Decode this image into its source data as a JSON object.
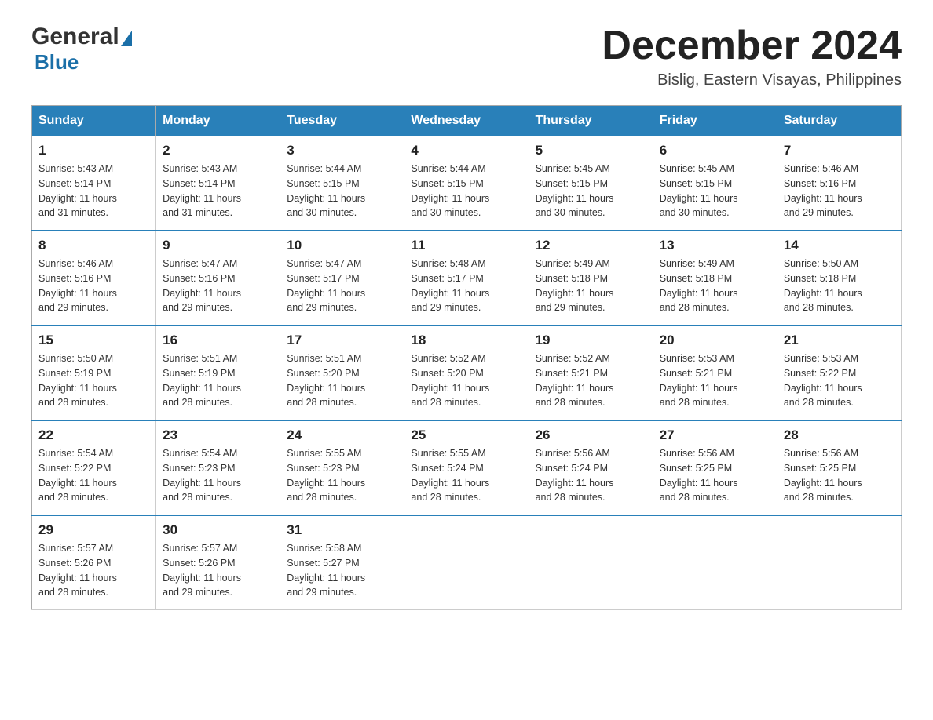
{
  "header": {
    "month_title": "December 2024",
    "location": "Bislig, Eastern Visayas, Philippines",
    "logo_general": "General",
    "logo_blue": "Blue"
  },
  "days_of_week": [
    "Sunday",
    "Monday",
    "Tuesday",
    "Wednesday",
    "Thursday",
    "Friday",
    "Saturday"
  ],
  "weeks": [
    [
      {
        "day": "1",
        "sunrise": "5:43 AM",
        "sunset": "5:14 PM",
        "daylight": "11 hours and 31 minutes."
      },
      {
        "day": "2",
        "sunrise": "5:43 AM",
        "sunset": "5:14 PM",
        "daylight": "11 hours and 31 minutes."
      },
      {
        "day": "3",
        "sunrise": "5:44 AM",
        "sunset": "5:15 PM",
        "daylight": "11 hours and 30 minutes."
      },
      {
        "day": "4",
        "sunrise": "5:44 AM",
        "sunset": "5:15 PM",
        "daylight": "11 hours and 30 minutes."
      },
      {
        "day": "5",
        "sunrise": "5:45 AM",
        "sunset": "5:15 PM",
        "daylight": "11 hours and 30 minutes."
      },
      {
        "day": "6",
        "sunrise": "5:45 AM",
        "sunset": "5:15 PM",
        "daylight": "11 hours and 30 minutes."
      },
      {
        "day": "7",
        "sunrise": "5:46 AM",
        "sunset": "5:16 PM",
        "daylight": "11 hours and 29 minutes."
      }
    ],
    [
      {
        "day": "8",
        "sunrise": "5:46 AM",
        "sunset": "5:16 PM",
        "daylight": "11 hours and 29 minutes."
      },
      {
        "day": "9",
        "sunrise": "5:47 AM",
        "sunset": "5:16 PM",
        "daylight": "11 hours and 29 minutes."
      },
      {
        "day": "10",
        "sunrise": "5:47 AM",
        "sunset": "5:17 PM",
        "daylight": "11 hours and 29 minutes."
      },
      {
        "day": "11",
        "sunrise": "5:48 AM",
        "sunset": "5:17 PM",
        "daylight": "11 hours and 29 minutes."
      },
      {
        "day": "12",
        "sunrise": "5:49 AM",
        "sunset": "5:18 PM",
        "daylight": "11 hours and 29 minutes."
      },
      {
        "day": "13",
        "sunrise": "5:49 AM",
        "sunset": "5:18 PM",
        "daylight": "11 hours and 28 minutes."
      },
      {
        "day": "14",
        "sunrise": "5:50 AM",
        "sunset": "5:18 PM",
        "daylight": "11 hours and 28 minutes."
      }
    ],
    [
      {
        "day": "15",
        "sunrise": "5:50 AM",
        "sunset": "5:19 PM",
        "daylight": "11 hours and 28 minutes."
      },
      {
        "day": "16",
        "sunrise": "5:51 AM",
        "sunset": "5:19 PM",
        "daylight": "11 hours and 28 minutes."
      },
      {
        "day": "17",
        "sunrise": "5:51 AM",
        "sunset": "5:20 PM",
        "daylight": "11 hours and 28 minutes."
      },
      {
        "day": "18",
        "sunrise": "5:52 AM",
        "sunset": "5:20 PM",
        "daylight": "11 hours and 28 minutes."
      },
      {
        "day": "19",
        "sunrise": "5:52 AM",
        "sunset": "5:21 PM",
        "daylight": "11 hours and 28 minutes."
      },
      {
        "day": "20",
        "sunrise": "5:53 AM",
        "sunset": "5:21 PM",
        "daylight": "11 hours and 28 minutes."
      },
      {
        "day": "21",
        "sunrise": "5:53 AM",
        "sunset": "5:22 PM",
        "daylight": "11 hours and 28 minutes."
      }
    ],
    [
      {
        "day": "22",
        "sunrise": "5:54 AM",
        "sunset": "5:22 PM",
        "daylight": "11 hours and 28 minutes."
      },
      {
        "day": "23",
        "sunrise": "5:54 AM",
        "sunset": "5:23 PM",
        "daylight": "11 hours and 28 minutes."
      },
      {
        "day": "24",
        "sunrise": "5:55 AM",
        "sunset": "5:23 PM",
        "daylight": "11 hours and 28 minutes."
      },
      {
        "day": "25",
        "sunrise": "5:55 AM",
        "sunset": "5:24 PM",
        "daylight": "11 hours and 28 minutes."
      },
      {
        "day": "26",
        "sunrise": "5:56 AM",
        "sunset": "5:24 PM",
        "daylight": "11 hours and 28 minutes."
      },
      {
        "day": "27",
        "sunrise": "5:56 AM",
        "sunset": "5:25 PM",
        "daylight": "11 hours and 28 minutes."
      },
      {
        "day": "28",
        "sunrise": "5:56 AM",
        "sunset": "5:25 PM",
        "daylight": "11 hours and 28 minutes."
      }
    ],
    [
      {
        "day": "29",
        "sunrise": "5:57 AM",
        "sunset": "5:26 PM",
        "daylight": "11 hours and 28 minutes."
      },
      {
        "day": "30",
        "sunrise": "5:57 AM",
        "sunset": "5:26 PM",
        "daylight": "11 hours and 29 minutes."
      },
      {
        "day": "31",
        "sunrise": "5:58 AM",
        "sunset": "5:27 PM",
        "daylight": "11 hours and 29 minutes."
      },
      null,
      null,
      null,
      null
    ]
  ],
  "labels": {
    "sunrise_prefix": "Sunrise: ",
    "sunset_prefix": "Sunset: ",
    "daylight_prefix": "Daylight: "
  }
}
